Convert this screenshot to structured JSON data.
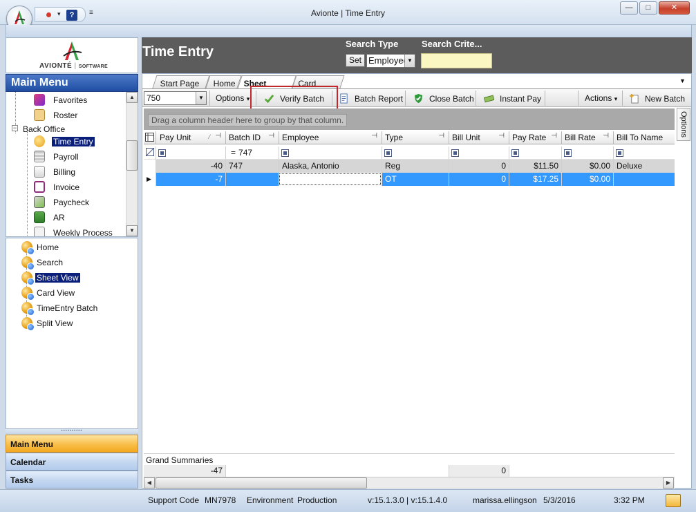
{
  "window": {
    "title": "Avionte | Time Entry",
    "min_glyph": "—",
    "max_glyph": "□",
    "close_glyph": "✕",
    "qat_help": "?",
    "qat_dropdown": "▾",
    "qat_more": "≡"
  },
  "brand": {
    "name": "AVIONTÉ",
    "separator": "|",
    "suffix": "SOFTWARE",
    "accent_red": "#d9232e",
    "accent_green": "#3aa34a"
  },
  "main_menu": {
    "title": "Main Menu",
    "items": [
      {
        "label": "Favorites",
        "icon": "favorites-icon"
      },
      {
        "label": "Roster",
        "icon": "roster-icon"
      },
      {
        "label": "Back Office",
        "icon": "folder-icon"
      },
      {
        "label": "Time Entry",
        "icon": "clock-icon",
        "selected": true
      },
      {
        "label": "Payroll",
        "icon": "calculator-icon"
      },
      {
        "label": "Billing",
        "icon": "billing-icon"
      },
      {
        "label": "Invoice",
        "icon": "invoice-icon"
      },
      {
        "label": "Paycheck",
        "icon": "paycheck-icon"
      },
      {
        "label": "AR",
        "icon": "ar-icon"
      },
      {
        "label": "Weekly Process",
        "icon": "calendar-icon"
      }
    ],
    "collapse_glyph": "−"
  },
  "views": {
    "items": [
      {
        "label": "Home"
      },
      {
        "label": "Search"
      },
      {
        "label": "Sheet View",
        "selected": true
      },
      {
        "label": "Card View"
      },
      {
        "label": "TimeEntry Batch"
      },
      {
        "label": "Split View"
      }
    ]
  },
  "nav_buttons": {
    "main_menu": "Main Menu",
    "calendar": "Calendar",
    "tasks": "Tasks",
    "grip": "••••••••••"
  },
  "header": {
    "title": "Time Entry",
    "search_type_label": "Search Type",
    "set_label": "Set",
    "search_type_value": "Employee",
    "search_criteria_label": "Search Crite...",
    "search_criteria_value": ""
  },
  "tabs": [
    {
      "label": "Start Page"
    },
    {
      "label": "Home"
    },
    {
      "label": "Sheet View",
      "active": true
    },
    {
      "label": "Card View"
    }
  ],
  "toolbar": {
    "batch_value": "750",
    "options_label": "Options",
    "verify_batch": "Verify Batch",
    "batch_report": "Batch Report",
    "close_batch": "Close Batch",
    "instant_pay": "Instant Pay",
    "actions_label": "Actions",
    "new_batch": "New Batch",
    "dropdown_glyph": "▾"
  },
  "side_tab": {
    "options": "Options"
  },
  "grid": {
    "group_hint": "Drag a column header here to group by that column.",
    "columns": [
      "Pay Unit",
      "Batch ID",
      "Employee",
      "Type",
      "Bill Unit",
      "Pay Rate",
      "Bill Rate",
      "Bill To Name"
    ],
    "pin_glyph": "⊣",
    "filter_row": {
      "batch_id_op": "=",
      "batch_id_value": "747"
    },
    "rows": [
      {
        "pay_unit": "-40",
        "batch_id": "747",
        "employee": "Alaska, Antonio",
        "type": "Reg",
        "bill_unit": "0",
        "pay_rate": "$11.50",
        "bill_rate": "$0.00",
        "bill_to": "Deluxe"
      },
      {
        "pay_unit": "-7",
        "batch_id": "",
        "employee": "",
        "type": "OT",
        "bill_unit": "0",
        "pay_rate": "$17.25",
        "bill_rate": "$0.00",
        "bill_to": ""
      }
    ],
    "row_indicator": "▶",
    "grand_summaries_label": "Grand Summaries",
    "summary_pay_unit": "-47",
    "summary_bill_unit": "0"
  },
  "status": {
    "support_code_label": "Support Code",
    "support_code": "MN7978",
    "environment_label": "Environment",
    "environment": "Production",
    "version": "v:15.1.3.0 | v:15.1.4.0",
    "user": "marissa.ellingson",
    "date": "5/3/2016",
    "time": "3:32 PM"
  }
}
